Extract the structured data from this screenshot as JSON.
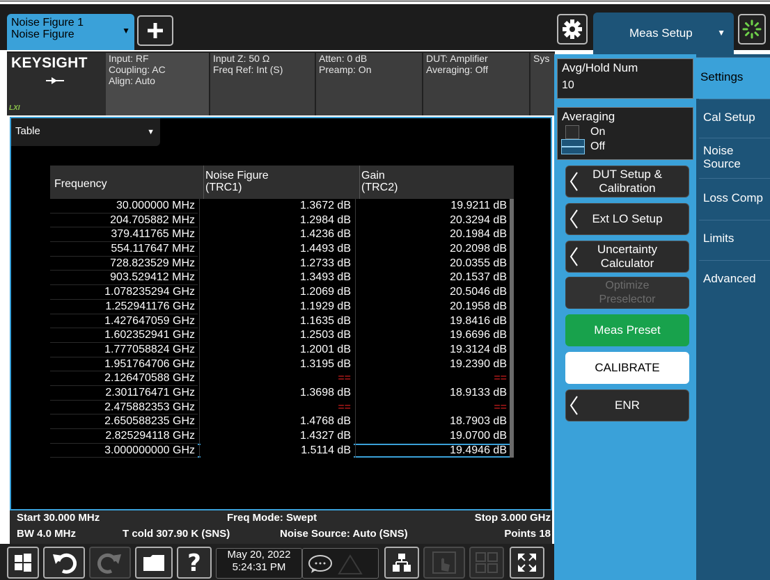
{
  "measurement": {
    "line1": "Noise Figure 1",
    "line2": "Noise Figure"
  },
  "menu": {
    "title": "Meas Setup"
  },
  "brand": {
    "name": "KEYSIGHT",
    "badge": "LXI"
  },
  "info": {
    "col1": [
      "Input: RF",
      "Coupling: AC",
      "Align: Auto"
    ],
    "col2": [
      "Input Z: 50 Ω",
      "Freq Ref: Int (S)"
    ],
    "col3": [
      "Atten: 0 dB",
      "Preamp: On"
    ],
    "col4": [
      "DUT: Amplifier",
      "Averaging: Off"
    ],
    "col5": [
      "Sys"
    ]
  },
  "view": {
    "selected": "Table"
  },
  "table": {
    "headers": {
      "freq": "Frequency",
      "nf_line1": "Noise Figure",
      "nf_line2": "(TRC1)",
      "gain_line1": "Gain",
      "gain_line2": "(TRC2)"
    },
    "rows": [
      {
        "freq": "30.000000 MHz",
        "nf": "1.3672 dB",
        "gain": "19.9211 dB"
      },
      {
        "freq": "204.705882 MHz",
        "nf": "1.2984 dB",
        "gain": "20.3294 dB"
      },
      {
        "freq": "379.411765 MHz",
        "nf": "1.4236 dB",
        "gain": "20.1984 dB"
      },
      {
        "freq": "554.117647 MHz",
        "nf": "1.4493 dB",
        "gain": "20.2098 dB"
      },
      {
        "freq": "728.823529 MHz",
        "nf": "1.2733 dB",
        "gain": "20.0355 dB"
      },
      {
        "freq": "903.529412 MHz",
        "nf": "1.3493 dB",
        "gain": "20.1537 dB"
      },
      {
        "freq": "1.078235294 GHz",
        "nf": "1.2069 dB",
        "gain": "20.5046 dB"
      },
      {
        "freq": "1.252941176 GHz",
        "nf": "1.1929 dB",
        "gain": "20.1958 dB"
      },
      {
        "freq": "1.427647059 GHz",
        "nf": "1.1635 dB",
        "gain": "19.8416 dB"
      },
      {
        "freq": "1.602352941 GHz",
        "nf": "1.2503 dB",
        "gain": "19.6696 dB"
      },
      {
        "freq": "1.777058824 GHz",
        "nf": "1.2001 dB",
        "gain": "19.3124 dB"
      },
      {
        "freq": "1.951764706 GHz",
        "nf": "1.3195 dB",
        "gain": "19.2390 dB"
      },
      {
        "freq": "2.126470588 GHz",
        "nf": "==",
        "gain": "=="
      },
      {
        "freq": "2.301176471 GHz",
        "nf": "1.3698 dB",
        "gain": "18.9133 dB"
      },
      {
        "freq": "2.475882353 GHz",
        "nf": "==",
        "gain": "=="
      },
      {
        "freq": "2.650588235 GHz",
        "nf": "1.4768 dB",
        "gain": "18.7903 dB"
      },
      {
        "freq": "2.825294118 GHz",
        "nf": "1.4327 dB",
        "gain": "19.0700 dB"
      },
      {
        "freq": "3.000000000 GHz",
        "nf": "1.5114 dB",
        "gain": "19.4946 dB"
      }
    ]
  },
  "status": {
    "start": "Start 30.000 MHz",
    "freq_mode": "Freq Mode: Swept",
    "stop": "Stop 3.000 GHz",
    "bw": "BW 4.0 MHz",
    "tcold": "T cold 307.90 K (SNS)",
    "noise_source": "Noise Source: Auto (SNS)",
    "points": "Points 18"
  },
  "clock": {
    "date": "May 20, 2022",
    "time": "5:24:31 PM"
  },
  "settings": {
    "avg_hold_label": "Avg/Hold Num",
    "avg_hold_value": "10",
    "averaging_label": "Averaging",
    "on_label": "On",
    "off_label": "Off",
    "averaging_state": "Off"
  },
  "buttons": {
    "dut_setup": [
      "DUT Setup &",
      "Calibration"
    ],
    "ext_lo": "Ext LO Setup",
    "uncertainty": [
      "Uncertainty",
      "Calculator"
    ],
    "optimize": [
      "Optimize",
      "Preselector"
    ],
    "meas_preset": "Meas Preset",
    "calibrate": "CALIBRATE",
    "enr": "ENR"
  },
  "tabs": [
    {
      "label": "Settings",
      "active": true
    },
    {
      "label": "Cal Setup",
      "active": false
    },
    {
      "label": "Noise Source",
      "active": false
    },
    {
      "label": "Loss Comp",
      "active": false
    },
    {
      "label": "Limits",
      "active": false
    },
    {
      "label": "Advanced",
      "active": false
    }
  ],
  "icons": {
    "windows": "windows-icon",
    "undo": "undo-icon",
    "redo": "redo-icon",
    "folder": "folder-icon",
    "help": "help-icon",
    "message": "message-icon",
    "warning": "warning-icon",
    "layout": "window-layout-icon",
    "touch": "touch-icon",
    "multi": "multi-window-icon",
    "fullscreen": "fullscreen-icon",
    "gear": "gear-icon",
    "busy": "busy-spinner-icon",
    "plus": "plus-icon"
  },
  "colors": {
    "accent": "#3aa1d9",
    "dark_accent": "#1d5478",
    "preset_green": "#18a24c",
    "invalid_red": "#e02020"
  }
}
